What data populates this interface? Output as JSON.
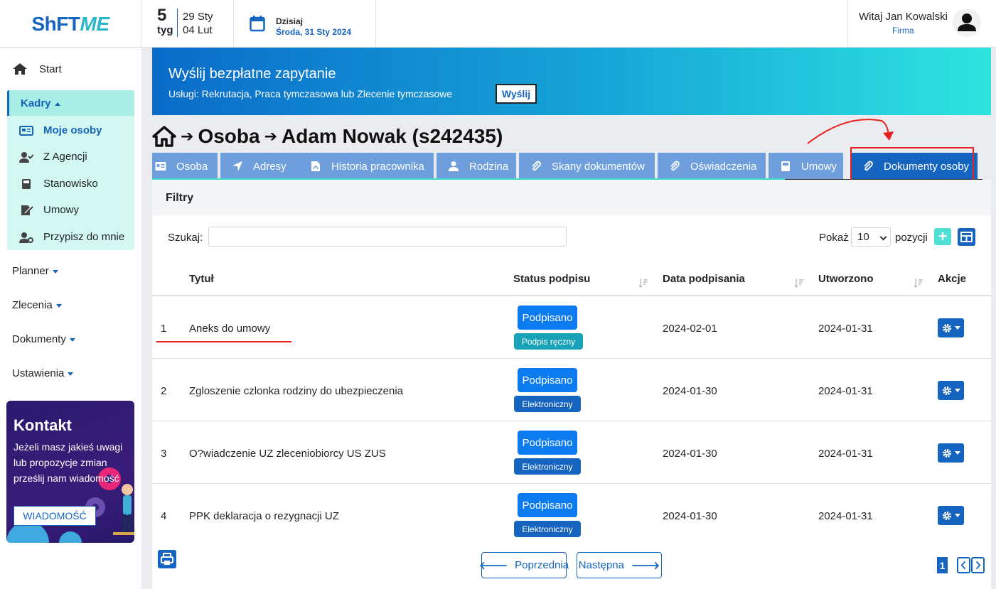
{
  "topbar": {
    "logo_a": "ShFT",
    "logo_b": "ME",
    "week_num": "5",
    "week_label": "tyg",
    "week_from": "29 Sty",
    "week_to": "04 Lut",
    "today_label": "Dzisiaj",
    "today_date": "Środa, 31 Sty 2024",
    "greeting": "Witaj Jan Kowalski",
    "firm": "Firma"
  },
  "sidebar": {
    "start": "Start",
    "kadry": "Kadry",
    "kadry_items": [
      "Moje osoby",
      "Z Agencji",
      "Stanowisko",
      "Umowy",
      "Przypisz do mnie"
    ],
    "planner": "Planner",
    "zlecenia": "Zlecenia",
    "dokumenty": "Dokumenty",
    "ustawienia": "Ustawienia",
    "contact_title": "Kontakt",
    "contact_text": "Jeżeli masz jakieś uwagi lub propozycje zmian prześlij nam wiadomość",
    "contact_button": "WIADOMOŚĆ"
  },
  "banner": {
    "title": "Wyślij bezpłatne zapytanie",
    "subtitle": "Usługi: Rekrutacja, Praca tymczasowa lub Zlecenie tymczasowe",
    "button": "Wyślij"
  },
  "breadcrumb": {
    "part1": "Osoba",
    "part2": "Adam Nowak (s242435)"
  },
  "tabs": [
    "Osoba",
    "Adresy",
    "Historia pracownika",
    "Rodzina",
    "Skany dokumentów",
    "Oświadczenia",
    "Umowy",
    "Dokumenty osoby"
  ],
  "filters": {
    "title": "Filtry",
    "search_label": "Szukaj:",
    "search_value": "",
    "show_label": "Pokaż",
    "show_value": "10",
    "positions_label": "pozycji",
    "plus": "+"
  },
  "table": {
    "headers": [
      "Tytuł",
      "Status podpisu",
      "Data podpisania",
      "Utworzono",
      "Akcje"
    ],
    "rows": [
      {
        "n": "1",
        "title": "Aneks do umowy",
        "status": "Podpisano",
        "method": "Podpis ręczny",
        "signed": "2024-02-01",
        "created": "2024-01-31"
      },
      {
        "n": "2",
        "title": "Zgloszenie czlonka rodziny do ubezpieczenia",
        "status": "Podpisano",
        "method": "Elektroniczny",
        "signed": "2024-01-30",
        "created": "2024-01-31"
      },
      {
        "n": "3",
        "title": "O?wiadczenie UZ zleceniobiorcy US ZUS",
        "status": "Podpisano",
        "method": "Elektroniczny",
        "signed": "2024-01-30",
        "created": "2024-01-31"
      },
      {
        "n": "4",
        "title": "PPK deklaracja o rezygnacji UZ",
        "status": "Podpisano",
        "method": "Elektroniczny",
        "signed": "2024-01-30",
        "created": "2024-01-31"
      }
    ]
  },
  "pager": {
    "prev": "Poprzednia",
    "next": "Następna",
    "page": "1"
  },
  "colors": {
    "primary": "#1565c0",
    "badge_blue": "#0d7bf0",
    "teal": "#17a2b8",
    "annotation_red": "#e82020"
  }
}
